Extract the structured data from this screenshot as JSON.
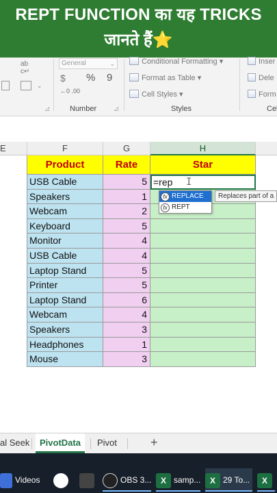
{
  "banner": {
    "line1": "REPT FUNCTION का यह TRICKS",
    "line2": "जानते हैं",
    "star_glyph": "⭐"
  },
  "ribbon": {
    "number_format": "General",
    "percent": "%",
    "comma": "9",
    "inc_dec_decimals": "←0 .00",
    "conditional_formatting": "Conditional Formatting ▾",
    "format_as_table": "Format as Table ▾",
    "cell_styles": "Cell Styles ▾",
    "insert": "Inser",
    "delete": "Dele",
    "format": "Form",
    "group_number": "Number",
    "group_styles": "Styles",
    "group_cells": "Cell",
    "currency": "$",
    "percent_icon": "%"
  },
  "columns": [
    {
      "letter": "E"
    },
    {
      "letter": "F"
    },
    {
      "letter": "G"
    },
    {
      "letter": "H"
    }
  ],
  "table": {
    "headers": {
      "product": "Product",
      "rate": "Rate",
      "star": "Star"
    },
    "rows": [
      {
        "product": "USB Cable",
        "rate": "5",
        "star": "=rep"
      },
      {
        "product": "Speakers",
        "rate": "1",
        "star": ""
      },
      {
        "product": "Webcam",
        "rate": "2",
        "star": ""
      },
      {
        "product": "Keyboard",
        "rate": "5",
        "star": ""
      },
      {
        "product": "Monitor",
        "rate": "4",
        "star": ""
      },
      {
        "product": "USB Cable",
        "rate": "4",
        "star": ""
      },
      {
        "product": "Laptop Stand",
        "rate": "5",
        "star": ""
      },
      {
        "product": "Printer",
        "rate": "5",
        "star": ""
      },
      {
        "product": "Laptop Stand",
        "rate": "6",
        "star": ""
      },
      {
        "product": "Webcam",
        "rate": "4",
        "star": ""
      },
      {
        "product": "Speakers",
        "rate": "3",
        "star": ""
      },
      {
        "product": "Headphones",
        "rate": "1",
        "star": ""
      },
      {
        "product": "Mouse",
        "rate": "3",
        "star": ""
      }
    ]
  },
  "autocomplete": {
    "items": [
      "REPLACE",
      "REPT"
    ],
    "fx": "fx",
    "tooltip": "Replaces part of a"
  },
  "sheet_tabs": {
    "tabs": [
      "al Seek",
      "PivotData",
      "Pivot"
    ],
    "active": "PivotData",
    "add": "+"
  },
  "taskbar": {
    "videos": "Videos",
    "obs": "OBS 3...",
    "excel1": "samp...",
    "excel2": "29 To...",
    "xl_letter": "X"
  },
  "colors": {
    "banner_bg": "#2e7d32",
    "product_fill": "#bde2f0",
    "rate_fill": "#f1cff1",
    "star_fill": "#c7efc8",
    "header_fill": "#ffff00",
    "header_text": "#c00000",
    "excel_green": "#217346"
  }
}
